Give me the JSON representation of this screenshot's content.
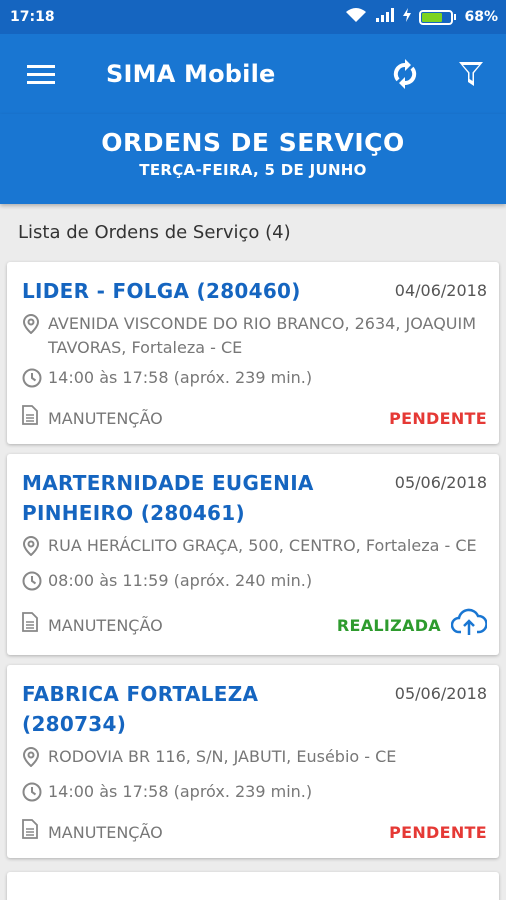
{
  "statusbar": {
    "time": "17:18",
    "battery": "68%",
    "battery_level": 0.68
  },
  "appbar": {
    "title": "SIMA Mobile"
  },
  "header": {
    "title": "ORDENS DE SERVIÇO",
    "subtitle": "TERÇA-FEIRA, 5 DE JUNHO"
  },
  "list": {
    "heading": "Lista de Ordens de Serviço (4)",
    "items": [
      {
        "title": "LIDER - FOLGA (280460)",
        "date": "04/06/2018",
        "address": "AVENIDA VISCONDE DO RIO BRANCO, 2634, JOAQUIM TAVORAS, Fortaleza - CE",
        "time": "14:00 às 17:58 (apróx. 239 min.)",
        "type": "MANUTENÇÃO",
        "status": "PENDENTE"
      },
      {
        "title": "MARTERNIDADE EUGENIA PINHEIRO (280461)",
        "date": "05/06/2018",
        "address": "RUA HERÁCLITO GRAÇA, 500, CENTRO, Fortaleza - CE",
        "time": "08:00 às 11:59 (apróx. 240 min.)",
        "type": "MANUTENÇÃO",
        "status": "REALIZADA"
      },
      {
        "title": "FABRICA FORTALEZA (280734)",
        "date": "05/06/2018",
        "address": "RODOVIA BR 116, S/N, JABUTI, Eusébio - CE",
        "time": "14:00 às 17:58 (apróx. 239 min.)",
        "type": "MANUTENÇÃO",
        "status": "PENDENTE"
      }
    ]
  },
  "colors": {
    "primary": "#1976d2",
    "statusbar": "#1565c0",
    "pending": "#e53935",
    "done": "#2e9b2e"
  },
  "icons": [
    "menu-icon",
    "sync-icon",
    "filter-icon",
    "location-icon",
    "clock-icon",
    "document-icon",
    "cloud-upload-icon",
    "wifi-icon",
    "signal-icon",
    "battery-icon"
  ]
}
